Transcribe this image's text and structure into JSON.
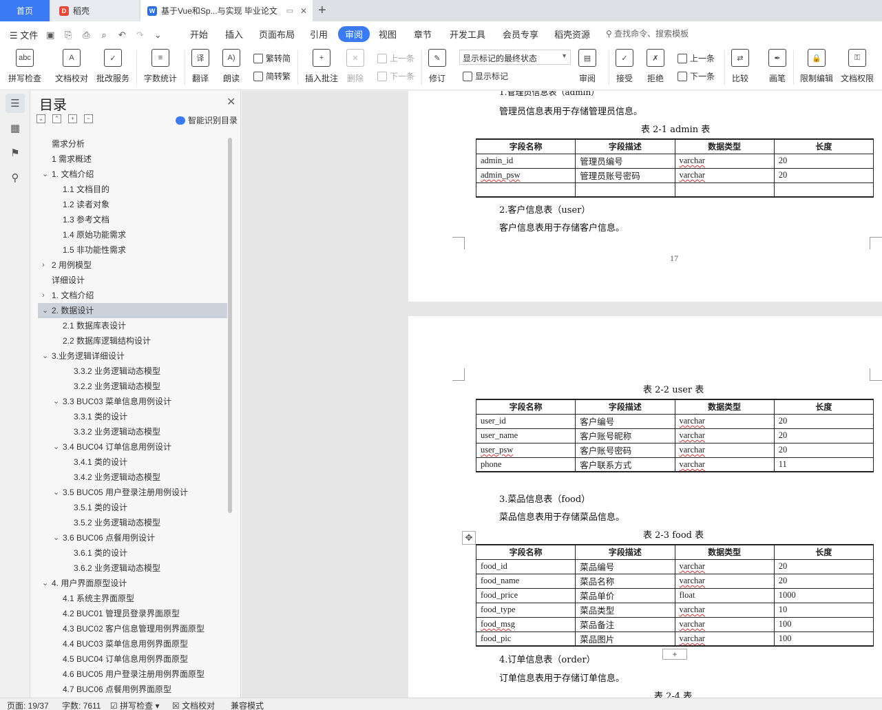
{
  "tabs": {
    "home": "首页",
    "daoke": "稻壳",
    "doc": "基于Vue和Sp...与实现 毕业论文"
  },
  "menu": {
    "file": "文件",
    "tabs": [
      "开始",
      "插入",
      "页面布局",
      "引用",
      "审阅",
      "视图",
      "章节",
      "开发工具",
      "会员专享",
      "稻壳资源"
    ],
    "active_tab": "审阅",
    "search_placeholder": "查找命令、搜索模板"
  },
  "ribbon": {
    "spell_check": "拼写检查",
    "doc_proof": "文档校对",
    "review_service": "批改服务",
    "word_count": "字数统计",
    "translate": "翻译",
    "read_aloud": "朗读",
    "trad_simp": "繁转简",
    "simp_trad": "简转繁",
    "insert_comment": "插入批注",
    "delete": "删除",
    "prev_comment": "上一条",
    "next_comment": "下一条",
    "track_changes": "修订",
    "markup_mode": "显示标记的最终状态",
    "show_markup": "显示标记",
    "review": "审阅",
    "accept": "接受",
    "reject": "拒绝",
    "prev_change": "上一条",
    "next_change": "下一条",
    "compare": "比较",
    "ink": "画笔",
    "restrict_edit": "限制编辑",
    "doc_permission": "文档权限"
  },
  "toc": {
    "title": "目录",
    "smart": "智能识别目录",
    "items": [
      {
        "label": "需求分析",
        "indent": 0,
        "arrow": ""
      },
      {
        "label": "1  需求概述",
        "indent": 0,
        "arrow": ""
      },
      {
        "label": "1.  文档介绍",
        "indent": 0,
        "arrow": "open"
      },
      {
        "label": "1.1  文档目的",
        "indent": 1,
        "arrow": ""
      },
      {
        "label": "1.2  读者对象",
        "indent": 1,
        "arrow": ""
      },
      {
        "label": "1.3  参考文档",
        "indent": 1,
        "arrow": ""
      },
      {
        "label": "1.4  原始功能需求",
        "indent": 1,
        "arrow": ""
      },
      {
        "label": "1.5  非功能性需求",
        "indent": 1,
        "arrow": ""
      },
      {
        "label": "2  用例模型",
        "indent": 0,
        "arrow": "closed"
      },
      {
        "label": "详细设计",
        "indent": 0,
        "arrow": ""
      },
      {
        "label": "1.  文档介绍",
        "indent": 0,
        "arrow": "closed"
      },
      {
        "label": "2.  数据设计",
        "indent": 0,
        "arrow": "open",
        "selected": true
      },
      {
        "label": "2.1  数据库表设计",
        "indent": 1,
        "arrow": ""
      },
      {
        "label": "2.2  数据库逻辑结构设计",
        "indent": 1,
        "arrow": ""
      },
      {
        "label": "3.业务逻辑详细设计",
        "indent": 0,
        "arrow": "open"
      },
      {
        "label": "3.3.2  业务逻辑动态模型",
        "indent": 2,
        "arrow": ""
      },
      {
        "label": "3.2.2  业务逻辑动态模型",
        "indent": 2,
        "arrow": ""
      },
      {
        "label": "3.3 BUC03  菜单信息用例设计",
        "indent": 1,
        "arrow": "open"
      },
      {
        "label": "3.3.1  类的设计",
        "indent": 2,
        "arrow": ""
      },
      {
        "label": "3.3.2  业务逻辑动态模型",
        "indent": 2,
        "arrow": ""
      },
      {
        "label": "3.4 BUC04  订单信息用例设计",
        "indent": 1,
        "arrow": "open"
      },
      {
        "label": "3.4.1  类的设计",
        "indent": 2,
        "arrow": ""
      },
      {
        "label": "3.4.2  业务逻辑动态模型",
        "indent": 2,
        "arrow": ""
      },
      {
        "label": "3.5 BUC05  用户登录注册用例设计",
        "indent": 1,
        "arrow": "open"
      },
      {
        "label": "3.5.1  类的设计",
        "indent": 2,
        "arrow": ""
      },
      {
        "label": "3.5.2  业务逻辑动态模型",
        "indent": 2,
        "arrow": ""
      },
      {
        "label": "3.6 BUC06  点餐用例设计",
        "indent": 1,
        "arrow": "open"
      },
      {
        "label": "3.6.1  类的设计",
        "indent": 2,
        "arrow": ""
      },
      {
        "label": "3.6.2  业务逻辑动态模型",
        "indent": 2,
        "arrow": ""
      },
      {
        "label": "4.  用户界面原型设计",
        "indent": 0,
        "arrow": "open"
      },
      {
        "label": "4.1  系统主界面原型",
        "indent": 1,
        "arrow": ""
      },
      {
        "label": "4.2 BUC01 管理员登录界面原型",
        "indent": 1,
        "arrow": ""
      },
      {
        "label": "4.3 BUC02  客户信息管理用例界面原型",
        "indent": 1,
        "arrow": ""
      },
      {
        "label": "4.4 BUC03  菜单信息用例界面原型",
        "indent": 1,
        "arrow": ""
      },
      {
        "label": "4.5 BUC04  订单信息用例界面原型",
        "indent": 1,
        "arrow": ""
      },
      {
        "label": "4.6 BUC05  用户登录注册用例界面原型",
        "indent": 1,
        "arrow": ""
      },
      {
        "label": "4.7 BUC06  点餐用例界面原型",
        "indent": 1,
        "arrow": ""
      }
    ]
  },
  "doc": {
    "p1_heading_partial": "1.管理员信息表（admin）",
    "p1_desc": "管理员信息表用于存储管理员信息。",
    "caption_admin": "表 2-1  admin 表",
    "headers": [
      "字段名称",
      "字段描述",
      "数据类型",
      "长度"
    ],
    "admin_rows": [
      [
        "admin_id",
        "管理员编号",
        "varchar",
        "20"
      ],
      [
        "admin_psw",
        "管理员账号密码",
        "varchar",
        "20"
      ],
      [
        "",
        "",
        "",
        ""
      ]
    ],
    "user_heading": "2.客户信息表（user）",
    "user_desc": "客户信息表用于存储客户信息。",
    "page_number": "17",
    "caption_user": "表 2-2  user 表",
    "user_rows": [
      [
        "user_id",
        "客户编号",
        "varchar",
        "20"
      ],
      [
        "user_name",
        "客户账号昵称",
        "varchar",
        "20"
      ],
      [
        "user_psw",
        "客户账号密码",
        "varchar",
        "20"
      ],
      [
        "phone",
        "客户联系方式",
        "varchar",
        "11"
      ]
    ],
    "food_heading": "3.菜品信息表（food）",
    "food_desc": "菜品信息表用于存储菜品信息。",
    "caption_food": "表 2-3  food 表",
    "food_rows": [
      [
        "food_id",
        "菜品编号",
        "varchar",
        "20"
      ],
      [
        "food_name",
        "菜品名称",
        "varchar",
        "20"
      ],
      [
        "food_price",
        "菜品单价",
        "float",
        "1000"
      ],
      [
        "food_type",
        "菜品类型",
        "varchar",
        "10"
      ],
      [
        "food_msg",
        "菜品备注",
        "varchar",
        "100"
      ],
      [
        "food_pic",
        "菜品图片",
        "varchar",
        "100"
      ]
    ],
    "order_heading": "4.订单信息表（order）",
    "order_desc": "订单信息表用于存储订单信息。",
    "caption_order_partial": "表 2-4  表"
  },
  "status": {
    "page": "页面: 19/37",
    "words": "字数: 7611",
    "spell": "拼写检查",
    "proof": "文档校对",
    "compat": "兼容模式"
  },
  "colors": {
    "accent": "#3a7bf5",
    "toc_selected": "#ccd2db"
  }
}
